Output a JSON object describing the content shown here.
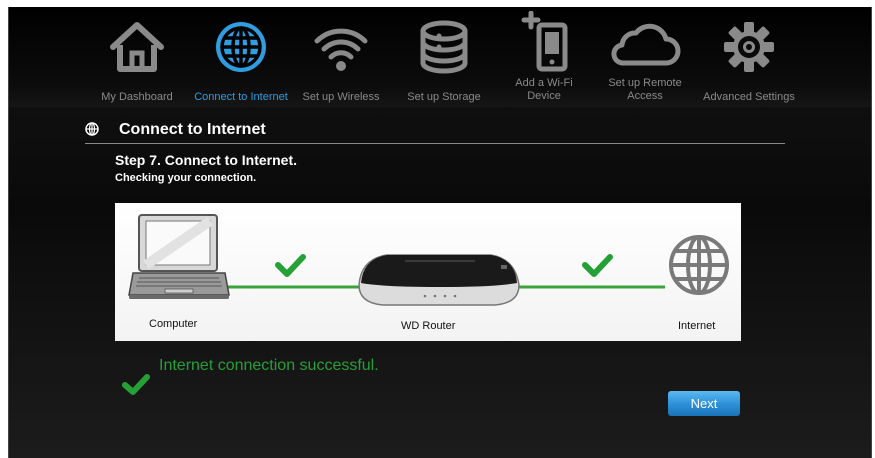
{
  "nav": {
    "items": [
      {
        "id": "dashboard",
        "label": "My Dashboard",
        "icon": "home-icon",
        "active": false
      },
      {
        "id": "internet",
        "label": "Connect to Internet",
        "icon": "globe-icon",
        "active": true
      },
      {
        "id": "wireless",
        "label": "Set up Wireless",
        "icon": "wifi-icon",
        "active": false
      },
      {
        "id": "storage",
        "label": "Set up Storage",
        "icon": "storage-icon",
        "active": false
      },
      {
        "id": "device",
        "label": "Add a Wi-Fi Device",
        "icon": "add-device-icon",
        "active": false
      },
      {
        "id": "remote",
        "label": "Set up Remote Access",
        "icon": "cloud-icon",
        "active": false
      },
      {
        "id": "advanced",
        "label": "Advanced Settings",
        "icon": "gear-icon",
        "active": false
      }
    ]
  },
  "page": {
    "section_title": "Connect to Internet",
    "step_title": "Step 7. Connect to Internet.",
    "step_subtitle": "Checking your connection."
  },
  "diagram": {
    "computer_label": "Computer",
    "router_label": "WD Router",
    "internet_label": "Internet"
  },
  "status": {
    "message": "Internet connection successful."
  },
  "buttons": {
    "next": "Next"
  },
  "colors": {
    "accent": "#2f9de0",
    "success": "#25a037",
    "link_line": "#3aa33a"
  }
}
